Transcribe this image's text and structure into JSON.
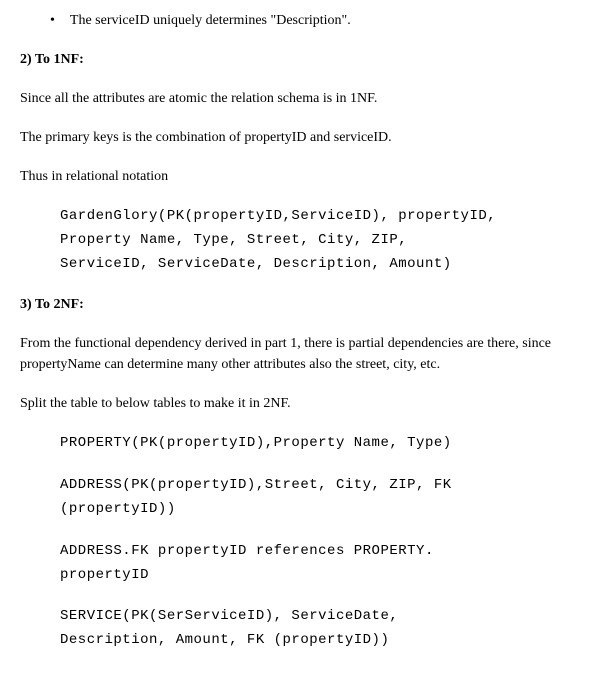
{
  "bullet1": "The serviceID uniquely determines \"Description\".",
  "heading2": "2) To 1NF:",
  "para1": "Since all the attributes are atomic the relation schema is in 1NF.",
  "para2": "The primary keys is the combination of propertyID and serviceID.",
  "para3": "Thus in relational notation",
  "code1_line1": "GardenGlory(PK(propertyID,ServiceID), propertyID,",
  "code1_line2": "Property Name, Type, Street, City, ZIP,",
  "code1_line3": "ServiceID, ServiceDate, Description, Amount)",
  "heading3": "3) To 2NF:",
  "para4": "From the functional dependency derived in part 1, there is partial dependencies are there, since propertyName can determine many other attributes also the street, city, etc.",
  "para5": "Split the table to below tables to make it in 2NF.",
  "code2": "PROPERTY(PK(propertyID),Property Name, Type)",
  "code3_line1": "ADDRESS(PK(propertyID),Street, City, ZIP, FK",
  "code3_line2": "(propertyID))",
  "code4_line1": "ADDRESS.FK propertyID references PROPERTY.",
  "code4_line2": "propertyID",
  "code5_line1": "SERVICE(PK(SerServiceID), ServiceDate,",
  "code5_line2": "Description, Amount, FK (propertyID))"
}
